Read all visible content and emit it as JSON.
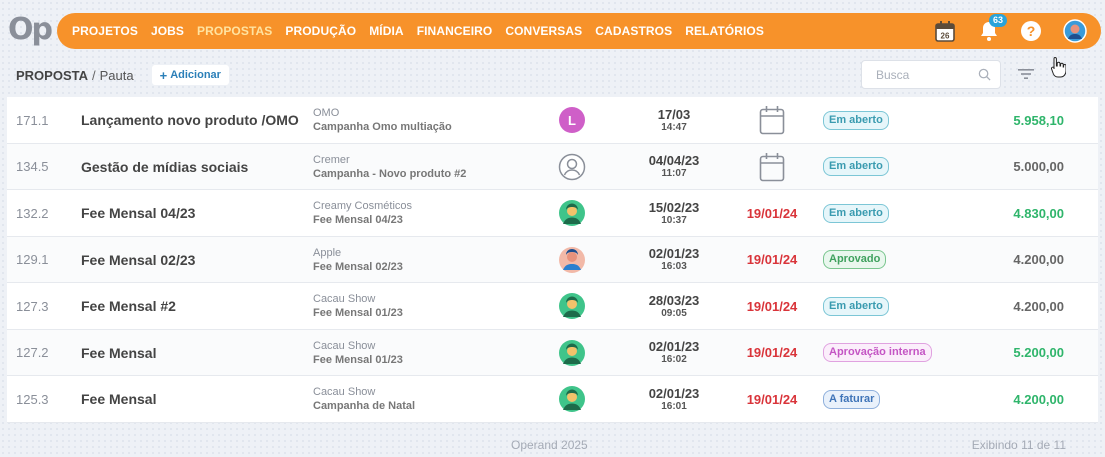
{
  "app": {
    "logo_text": "Op"
  },
  "nav": {
    "items": [
      {
        "label": "PROJETOS",
        "active": false
      },
      {
        "label": "JOBS",
        "active": false
      },
      {
        "label": "PROPOSTAS",
        "active": true
      },
      {
        "label": "PRODUÇÃO",
        "active": false
      },
      {
        "label": "MÍDIA",
        "active": false
      },
      {
        "label": "FINANCEIRO",
        "active": false
      },
      {
        "label": "CONVERSAS",
        "active": false
      },
      {
        "label": "CADASTROS",
        "active": false
      },
      {
        "label": "RELATÓRIOS",
        "active": false
      }
    ],
    "accent_color": "#f7922a"
  },
  "top_icons": {
    "calendar_day": "26",
    "notifications_count": "63",
    "icons": [
      "calendar-icon",
      "bell-icon",
      "help-icon",
      "user-avatar"
    ]
  },
  "breadcrumb": {
    "section": "PROPOSTA",
    "separator": "/",
    "page": "Pauta"
  },
  "toolbar": {
    "add_label": "Adicionar",
    "search_placeholder": "Busca"
  },
  "table": {
    "rows": [
      {
        "code": "171.1",
        "title": "Lançamento novo produto /OMO",
        "client": "OMO",
        "campaign": "Campanha Omo multiação",
        "avatar": "letter",
        "avatar_letter": "L",
        "date": "17/03",
        "time": "14:47",
        "due_icon": true,
        "due": "",
        "status": "Em aberto",
        "status_type": "open",
        "value": "5.958,10",
        "value_green": true
      },
      {
        "code": "134.5",
        "title": "Gestão de mídias sociais",
        "client": "Cremer",
        "campaign": "Campanha - Novo produto #2",
        "avatar": "outline",
        "avatar_letter": "",
        "date": "04/04/23",
        "time": "11:07",
        "due_icon": true,
        "due": "",
        "status": "Em aberto",
        "status_type": "open",
        "value": "5.000,00",
        "value_green": false
      },
      {
        "code": "132.2",
        "title": "Fee Mensal 04/23",
        "client": "Creamy Cosméticos",
        "campaign": "Fee Mensal 04/23",
        "avatar": "green",
        "avatar_letter": "",
        "date": "15/02/23",
        "time": "10:37",
        "due_icon": false,
        "due": "19/01/24",
        "status": "Em aberto",
        "status_type": "open",
        "value": "4.830,00",
        "value_green": true
      },
      {
        "code": "129.1",
        "title": "Fee Mensal 02/23",
        "client": "Apple",
        "campaign": "Fee Mensal 02/23",
        "avatar": "blue",
        "avatar_letter": "",
        "date": "02/01/23",
        "time": "16:03",
        "due_icon": false,
        "due": "19/01/24",
        "status": "Aprovado",
        "status_type": "approved",
        "value": "4.200,00",
        "value_green": false
      },
      {
        "code": "127.3",
        "title": "Fee Mensal #2",
        "client": "Cacau Show",
        "campaign": "Fee Mensal 01/23",
        "avatar": "green",
        "avatar_letter": "",
        "date": "28/03/23",
        "time": "09:05",
        "due_icon": false,
        "due": "19/01/24",
        "status": "Em aberto",
        "status_type": "open",
        "value": "4.200,00",
        "value_green": false
      },
      {
        "code": "127.2",
        "title": "Fee Mensal",
        "client": "Cacau Show",
        "campaign": "Fee Mensal 01/23",
        "avatar": "green",
        "avatar_letter": "",
        "date": "02/01/23",
        "time": "16:02",
        "due_icon": false,
        "due": "19/01/24",
        "status": "Aprovação interna",
        "status_type": "internal",
        "value": "5.200,00",
        "value_green": true
      },
      {
        "code": "125.3",
        "title": "Fee Mensal",
        "client": "Cacau Show",
        "campaign": "Campanha de Natal",
        "avatar": "green",
        "avatar_letter": "",
        "date": "02/01/23",
        "time": "16:01",
        "due_icon": false,
        "due": "19/01/24",
        "status": "A faturar",
        "status_type": "billing",
        "value": "4.200,00",
        "value_green": true
      }
    ]
  },
  "footer": {
    "copyright": "Operand 2025",
    "count": "Exibindo 11 de 11"
  }
}
